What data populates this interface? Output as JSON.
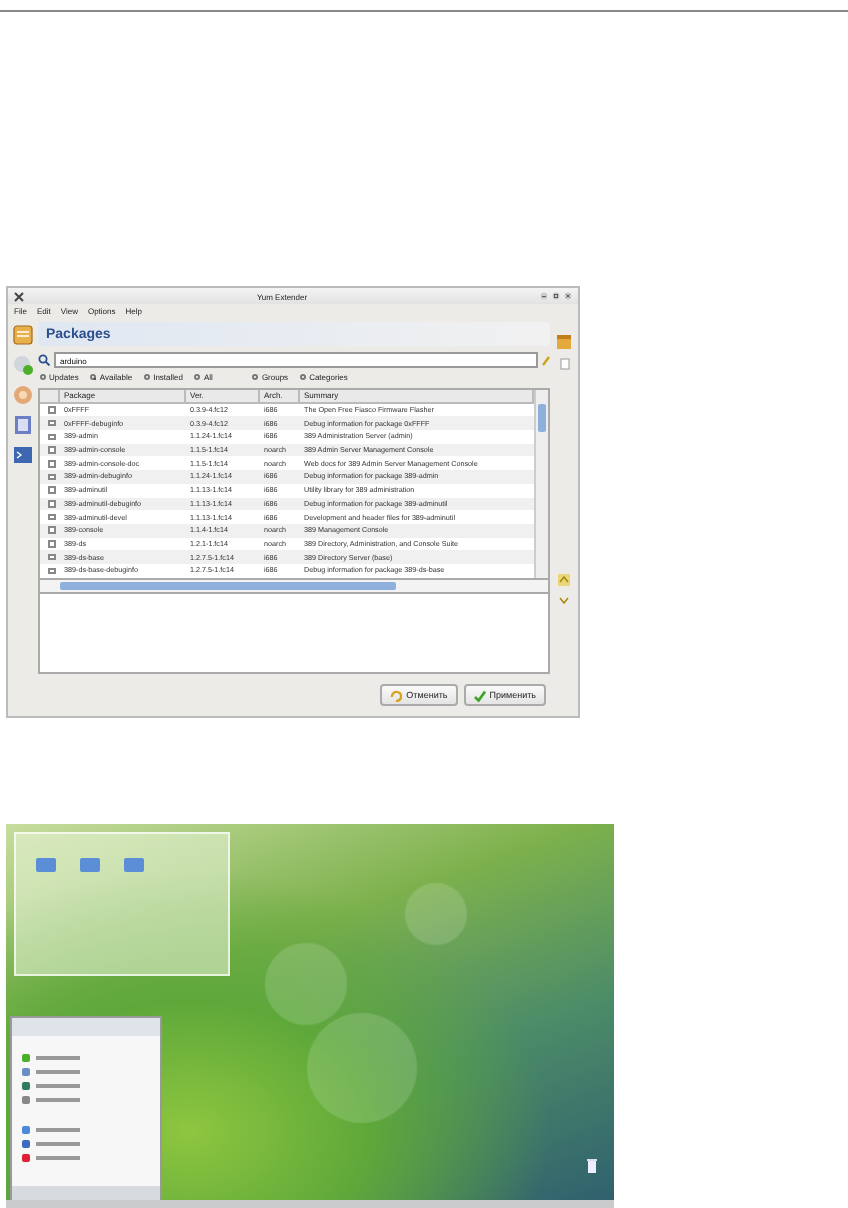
{
  "yum_window": {
    "title": "Yum Extender",
    "menu": [
      "File",
      "Edit",
      "View",
      "Options",
      "Help"
    ],
    "heading": "Packages",
    "search": {
      "value": "arduino"
    },
    "filters": [
      {
        "label": "Updates",
        "selected": false
      },
      {
        "label": "Available",
        "selected": true
      },
      {
        "label": "Installed",
        "selected": false
      },
      {
        "label": "All",
        "selected": false
      },
      {
        "label": "Groups",
        "selected": false
      },
      {
        "label": "Categories",
        "selected": false
      }
    ],
    "table": {
      "columns": [
        "Package",
        "Ver.",
        "Arch.",
        "Summary"
      ],
      "rows": [
        {
          "checked": false,
          "cells": [
            "0xFFFF",
            "0.3.9-4.fc12",
            "i686",
            "The Open Free Fiasco Firmware Flasher"
          ]
        },
        {
          "checked": false,
          "cells": [
            "0xFFFF-debuginfo",
            "0.3.9-4.fc12",
            "i686",
            "Debug information for package 0xFFFF"
          ]
        },
        {
          "checked": false,
          "cells": [
            "389-admin",
            "1.1.24-1.fc14",
            "i686",
            "389 Administration Server (admin)"
          ]
        },
        {
          "checked": false,
          "cells": [
            "389-admin-console",
            "1.1.5-1.fc14",
            "noarch",
            "389 Admin Server Management Console"
          ]
        },
        {
          "checked": false,
          "cells": [
            "389-admin-console-doc",
            "1.1.5-1.fc14",
            "noarch",
            "Web docs for 389 Admin Server Management Console"
          ]
        },
        {
          "checked": false,
          "cells": [
            "389-admin-debuginfo",
            "1.1.24-1.fc14",
            "i686",
            "Debug information for package 389-admin"
          ]
        },
        {
          "checked": false,
          "cells": [
            "389-adminutil",
            "1.1.13-1.fc14",
            "i686",
            "Utility library for 389 administration"
          ]
        },
        {
          "checked": false,
          "cells": [
            "389-adminutil-debuginfo",
            "1.1.13-1.fc14",
            "i686",
            "Debug information for package 389-adminutil"
          ]
        },
        {
          "checked": false,
          "cells": [
            "389-adminutil-devel",
            "1.1.13-1.fc14",
            "i686",
            "Development and header files for 389-adminutil"
          ]
        },
        {
          "checked": false,
          "cells": [
            "389-console",
            "1.1.4-1.fc14",
            "noarch",
            "389 Management Console"
          ]
        },
        {
          "checked": false,
          "cells": [
            "389-ds",
            "1.2.1-1.fc14",
            "noarch",
            "389 Directory, Administration, and Console Suite"
          ]
        },
        {
          "checked": false,
          "cells": [
            "389-ds-base",
            "1.2.7.5-1.fc14",
            "i686",
            "389 Directory Server (base)"
          ]
        },
        {
          "checked": false,
          "cells": [
            "389-ds-base-debuginfo",
            "1.2.7.5-1.fc14",
            "i686",
            "Debug information for package 389-ds-base"
          ]
        }
      ]
    },
    "buttons": [
      {
        "kind": "cancel",
        "label": "Отменить"
      },
      {
        "kind": "apply",
        "label": "Применить"
      }
    ]
  }
}
